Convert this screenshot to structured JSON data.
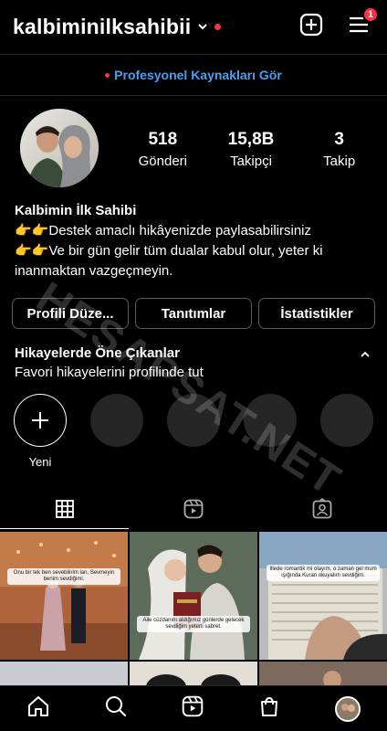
{
  "header": {
    "username": "kalbiminilksahibii",
    "notification_count": "1"
  },
  "professional": {
    "link_label": "Profesyonel Kaynakları Gör"
  },
  "stats": {
    "posts": {
      "value": "518",
      "label": "Gönderi"
    },
    "followers": {
      "value": "15,8B",
      "label": "Takipçi"
    },
    "following": {
      "value": "3",
      "label": "Takip"
    }
  },
  "bio": {
    "name": "Kalbimin İlk Sahibi",
    "line1": "Destek amaclı hikâyenizde paylasabilirsiniz",
    "line2": "Ve bir gün gelir tüm dualar kabul olur, yeter ki inanmaktan vazgeçmeyin."
  },
  "buttons": {
    "edit_profile": "Profili Düze...",
    "promotions": "Tanıtımlar",
    "insights": "İstatistikler"
  },
  "highlights": {
    "title": "Hikayelerde Öne Çıkanlar",
    "subtitle": "Favori hikayelerini profilinde tut",
    "new_label": "Yeni"
  },
  "posts": [
    {
      "caption": "Onu bir tek ben sevebilirim lan, Sevmeyin benim sevdiğimi."
    },
    {
      "caption": "Aile cüzdanını aldığımız günlerde gelecek sevdiğim yeterli sabret."
    },
    {
      "caption": "Illede romantik mi olayım, o zaman gel mum ışığında Kuran okuyalım sevdiğim."
    }
  ],
  "watermark": "HESAPSAT.NET",
  "colors": {
    "background": "#000000",
    "accent_link": "#4a9ff5",
    "notification_red": "#ff3040",
    "button_border": "#5a5a5a",
    "highlight_placeholder": "#262626"
  }
}
